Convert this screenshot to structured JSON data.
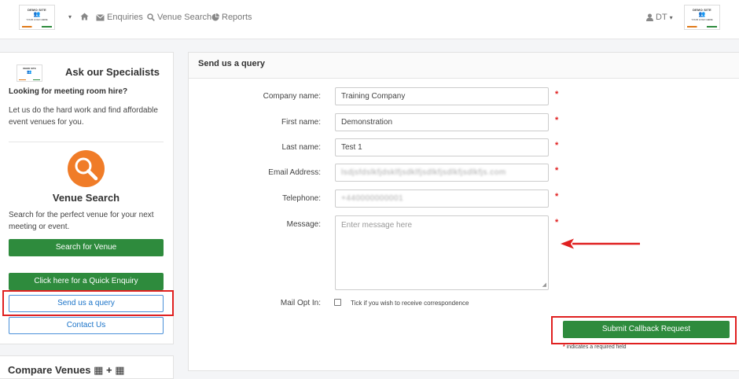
{
  "navbar": {
    "logo_brand": "DEMO SITE",
    "logo_tagline": "YOUR LOGO HERE",
    "caret": "▾",
    "home_icon": "home-icon",
    "enquiries": "Enquiries",
    "venue_search": "Venue Search",
    "reports": "Reports",
    "user": "DT"
  },
  "sidebar": {
    "logo_brand": "DEMO SITE",
    "heading": "Ask our Specialists",
    "looking": "Looking for meeting room hire?",
    "description": "Let us do the hard work and find affordable event venues for you.",
    "venue_title": "Venue Search",
    "venue_desc": "Search for the perfect venue for your next meeting or event.",
    "btn_search": "Search for Venue",
    "btn_quick": "Click here for a Quick Enquiry",
    "btn_query": "Send us a query",
    "btn_contact": "Contact Us",
    "compare": "Compare Venues"
  },
  "form": {
    "title": "Send us a query",
    "company_label": "Company name:",
    "company_value": "Training Company",
    "first_label": "First name:",
    "first_value": "Demonstration",
    "last_label": "Last name:",
    "last_value": "Test 1",
    "email_label": "Email Address:",
    "email_value": "lsdjsfdslkfjdsklfjsdklfjsdlkfjsdlkfjsdlkfjs.com",
    "phone_label": "Telephone:",
    "phone_value": "+440000000001",
    "message_label": "Message:",
    "message_placeholder": "Enter message here",
    "optin_label": "Mail Opt In:",
    "optin_text": "Tick if you wish to receive correspondence",
    "submit": "Submit Callback Request",
    "required_note": "indicates a required field",
    "required_mark": "*"
  },
  "colors": {
    "accent_green": "#2e8b3d",
    "highlight_red": "#e02020",
    "search_orange": "#f07c28",
    "link_blue": "#1a73c8"
  }
}
